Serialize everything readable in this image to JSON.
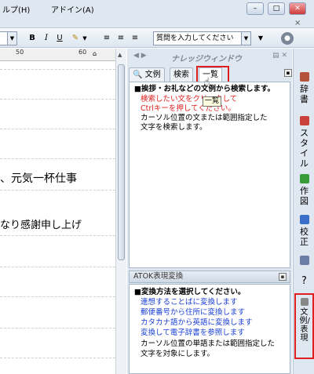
{
  "menubar": {
    "items": [
      "ルプ(H)",
      "アドイン(A)"
    ],
    "window_buttons": [
      "–",
      "□",
      "✕"
    ],
    "doc_close": "×"
  },
  "toolbar": {
    "style_combo": "",
    "bold": "B",
    "italic": "I",
    "underline": "U",
    "question_input": "質問を入力してください"
  },
  "ruler": {
    "marks": [
      "50",
      "60"
    ]
  },
  "document": {
    "lines": [
      "、元気一杯仕事",
      "なり感謝申し上げ"
    ]
  },
  "knowledge": {
    "title": "ナレッジウィンドウ",
    "nav": "◀ ▶",
    "tabs": [
      "文例",
      "検索",
      "一覧"
    ],
    "pane1": {
      "heading": "■挨拶・お礼などの文例から検索します。",
      "lines": [
        {
          "text": "検索したい文をクリックして",
          "color": "red"
        },
        {
          "text": "Ctrlキーを押してください。",
          "color": "red"
        },
        {
          "text": "カーソル位置の文または範囲指定した",
          "color": "black"
        },
        {
          "text": "文字を検索します。",
          "color": "black"
        }
      ]
    },
    "tooltip": "一覧",
    "atok": {
      "title": "ATOK表現変換",
      "heading": "■変換方法を選択してください。",
      "links": [
        "連想することばに変換します",
        "郵便番号から住所に変換します",
        "カタカナ語から英語に変換します",
        "変換して電子辞書を参照します"
      ],
      "note1": "カーソル位置の単語または範囲指定した",
      "note2": "文字を対象にします。"
    }
  },
  "sidebar": {
    "items": [
      {
        "label": "辞書",
        "icon": "dictionary-icon",
        "color": "#b5523b"
      },
      {
        "label": "スタイル",
        "icon": "style-icon",
        "color": "#c9413a"
      },
      {
        "label": "作図",
        "icon": "drawing-icon",
        "color": "#3a9b3a"
      },
      {
        "label": "校正",
        "icon": "proofread-icon",
        "color": "#3a6fc9"
      },
      {
        "label": "",
        "icon": "document-icon",
        "color": "#6a7ea8"
      },
      {
        "label": "?",
        "icon": "help-icon",
        "color": "#555555"
      },
      {
        "label": "文例/表現",
        "icon": "phrase-icon",
        "color": "#555555"
      }
    ]
  },
  "colors": {
    "highlight": "#e02020",
    "link": "#1a3fd6"
  }
}
